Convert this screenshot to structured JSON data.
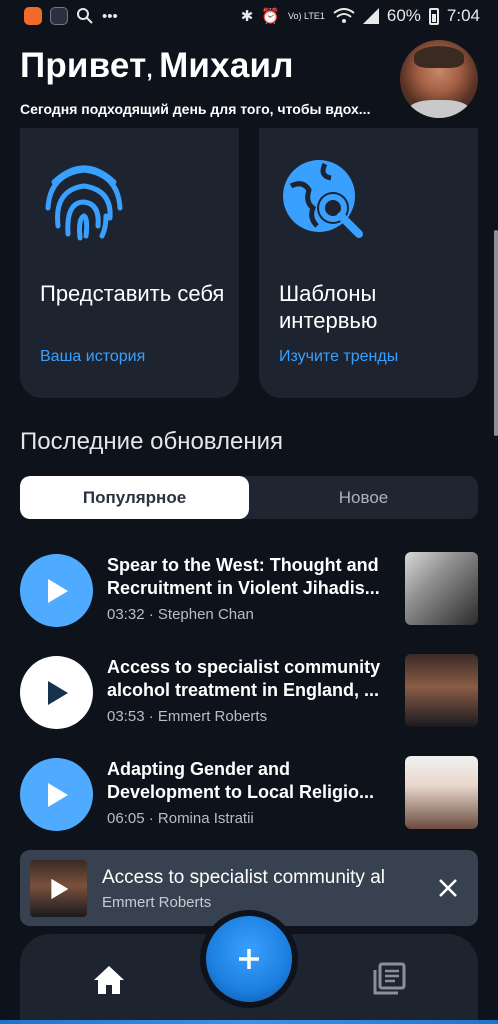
{
  "status_bar": {
    "battery_pct": "60%",
    "time": "7:04",
    "network_label": "Vo) LTE1"
  },
  "header": {
    "greeting_hello": "Привет",
    "greeting_name": "Михаил",
    "subtitle": "Сегодня подходящий день для того, чтобы вдох..."
  },
  "cards": [
    {
      "title": "Представить себя",
      "link": "Ваша история",
      "icon": "fingerprint-icon"
    },
    {
      "title": "Шаблоны интервью",
      "link": "Изучите тренды",
      "icon": "globe-search-icon"
    }
  ],
  "updates": {
    "section_title": "Последние обновления",
    "tabs": [
      {
        "label": "Популярное",
        "active": true
      },
      {
        "label": "Новое",
        "active": false
      }
    ],
    "items": [
      {
        "title_line1": "Spear to the West: Thought and",
        "title_line2": "Recruitment in Violent Jihadis...",
        "duration": "03:32",
        "author": "Stephen Chan",
        "play_style": "blue"
      },
      {
        "title_line1": "Access to specialist community",
        "title_line2": "alcohol treatment in England, ...",
        "duration": "03:53",
        "author": "Emmert Roberts",
        "play_style": "white"
      },
      {
        "title_line1": "Adapting Gender and",
        "title_line2": "Development to Local Religio...",
        "duration": "06:05",
        "author": "Romina Istratii",
        "play_style": "blue"
      }
    ]
  },
  "mini_player": {
    "title": "Access to specialist community al",
    "author": "Emmert Roberts"
  },
  "colors": {
    "background": "#0d121b",
    "card": "#1d242f",
    "accent": "#3aa0ff",
    "play_blue": "#4eabff"
  }
}
